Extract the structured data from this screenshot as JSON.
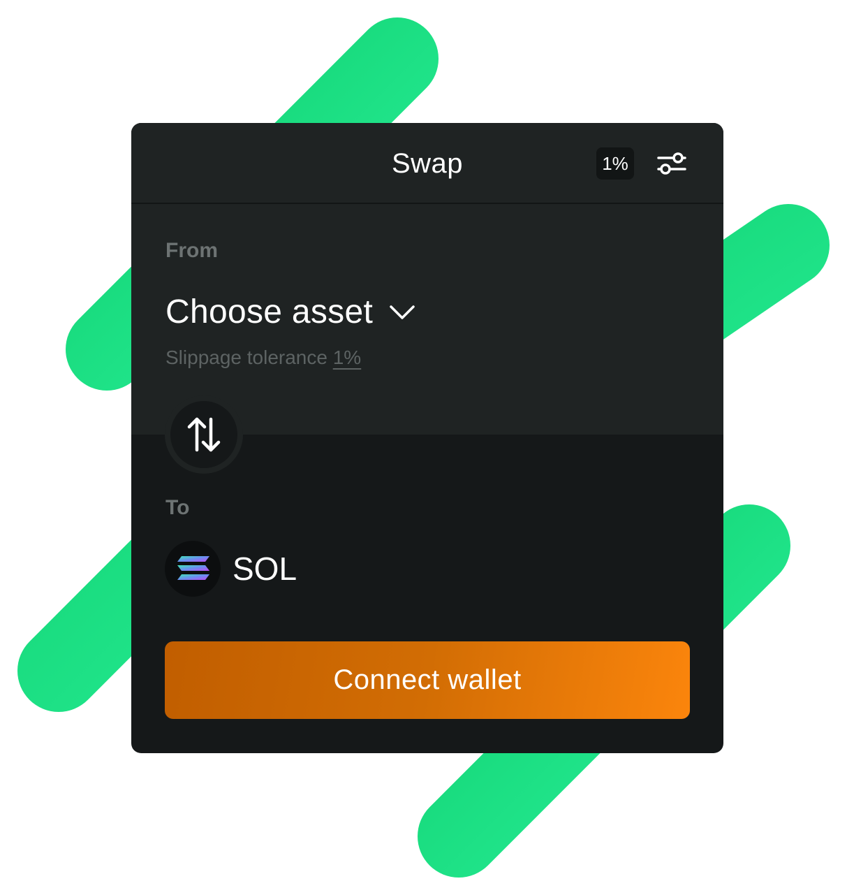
{
  "header": {
    "title": "Swap",
    "slippage_badge": "1%",
    "settings_icon": "sliders-icon"
  },
  "from": {
    "label": "From",
    "asset_placeholder": "Choose asset",
    "dropdown_icon": "chevron-down-icon",
    "slippage_text": "Slippage tolerance",
    "slippage_value": "1%"
  },
  "switch": {
    "icon": "swap-arrows-icon"
  },
  "to": {
    "label": "To",
    "token_symbol": "SOL",
    "token_icon": "solana-logo-icon"
  },
  "actions": {
    "connect_label": "Connect wallet"
  },
  "colors": {
    "accent_green": "#1ee38a",
    "button_orange_start": "#c15e00",
    "button_orange_end": "#fb850c",
    "card_dark": "#151819",
    "panel_dark": "#1f2323"
  }
}
